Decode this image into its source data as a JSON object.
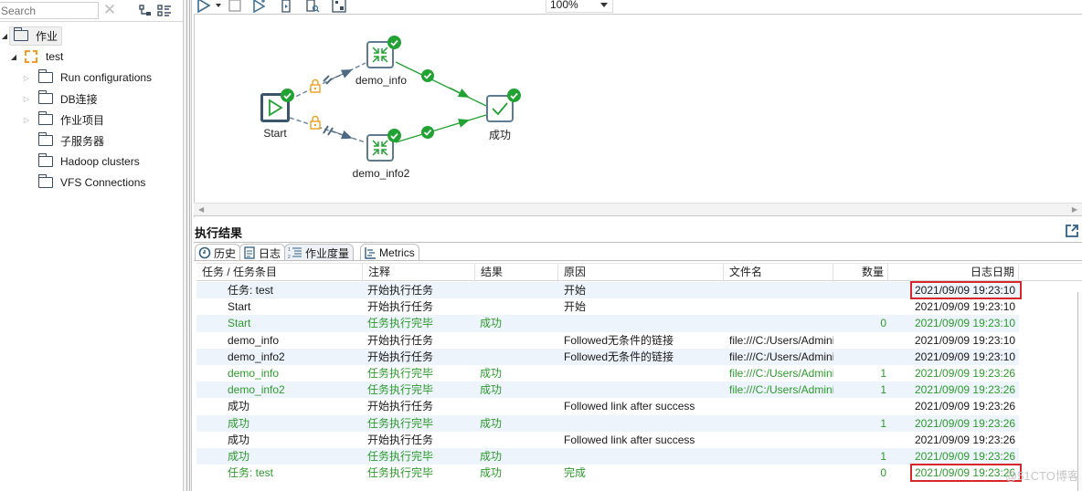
{
  "left_panel": {
    "search": {
      "placeholder": "Search",
      "value": ""
    },
    "tree": [
      {
        "label": "作业",
        "level": 0,
        "expanded": true,
        "icon": "folder-icon",
        "selected": true
      },
      {
        "label": "test",
        "level": 1,
        "expanded": true,
        "icon": "job-icon"
      },
      {
        "label": "Run configurations",
        "level": 2,
        "expandable": true,
        "icon": "folder-icon"
      },
      {
        "label": "DB连接",
        "level": 2,
        "expandable": true,
        "icon": "folder-icon"
      },
      {
        "label": "作业项目",
        "level": 2,
        "expandable": true,
        "icon": "folder-icon"
      },
      {
        "label": "子服务器",
        "level": 2,
        "expandable": false,
        "icon": "folder-icon"
      },
      {
        "label": "Hadoop clusters",
        "level": 2,
        "expandable": false,
        "icon": "folder-icon"
      },
      {
        "label": "VFS Connections",
        "level": 2,
        "expandable": false,
        "icon": "folder-icon"
      }
    ]
  },
  "toolbar": {
    "zoom_value": "100%",
    "icons": [
      "run-icon",
      "run-dropdown-icon",
      "stop-icon",
      "replay-icon",
      "verify-icon",
      "analyze-icon",
      "align-icon"
    ]
  },
  "canvas": {
    "nodes": [
      {
        "id": "start",
        "label": "Start",
        "icon": "play-icon",
        "status": "success"
      },
      {
        "id": "demo_info",
        "label": "demo_info",
        "icon": "transform-icon",
        "status": "success"
      },
      {
        "id": "demo_info2",
        "label": "demo_info2",
        "icon": "transform-icon",
        "status": "success"
      },
      {
        "id": "success",
        "label": "成功",
        "icon": "checkmark-icon",
        "status": "success"
      }
    ],
    "hops": [
      {
        "from": "start",
        "to": "demo_info",
        "type": "unconditional",
        "locked": true
      },
      {
        "from": "start",
        "to": "demo_info2",
        "type": "unconditional",
        "locked": true
      },
      {
        "from": "demo_info",
        "to": "success",
        "type": "on-success"
      },
      {
        "from": "demo_info2",
        "to": "success",
        "type": "on-success"
      }
    ]
  },
  "results": {
    "title": "执行结果",
    "tabs": [
      {
        "label": "历史",
        "icon": "history-icon",
        "active": false
      },
      {
        "label": "日志",
        "icon": "log-icon",
        "active": false
      },
      {
        "label": "作业度量",
        "icon": "metrics-list-icon",
        "active": true
      },
      {
        "label": "Metrics",
        "icon": "metrics-chart-icon",
        "active": false
      }
    ],
    "columns": [
      "任务 / 任务条目",
      "注释",
      "结果",
      "原因",
      "文件名",
      "数量",
      "日志日期"
    ],
    "rows": [
      {
        "task": "任务: test",
        "comment": "开始执行任务",
        "result": "",
        "reason": "开始",
        "filename": "",
        "count": "",
        "date": "2021/09/09 19:23:10",
        "status": "plain",
        "highlight": true
      },
      {
        "task": "Start",
        "comment": "开始执行任务",
        "result": "",
        "reason": "开始",
        "filename": "",
        "count": "",
        "date": "2021/09/09 19:23:10",
        "status": "plain"
      },
      {
        "task": "Start",
        "comment": "任务执行完毕",
        "result": "成功",
        "reason": "",
        "filename": "",
        "count": "0",
        "date": "2021/09/09 19:23:10",
        "status": "ok"
      },
      {
        "task": "demo_info",
        "comment": "开始执行任务",
        "result": "",
        "reason": "Followed无条件的链接",
        "filename": "file:///C:/Users/Admini...",
        "count": "",
        "date": "2021/09/09 19:23:10",
        "status": "plain"
      },
      {
        "task": "demo_info2",
        "comment": "开始执行任务",
        "result": "",
        "reason": "Followed无条件的链接",
        "filename": "file:///C:/Users/Admini...",
        "count": "",
        "date": "2021/09/09 19:23:10",
        "status": "plain"
      },
      {
        "task": "demo_info",
        "comment": "任务执行完毕",
        "result": "成功",
        "reason": "",
        "filename": "file:///C:/Users/Admini...",
        "count": "1",
        "date": "2021/09/09 19:23:26",
        "status": "ok"
      },
      {
        "task": "demo_info2",
        "comment": "任务执行完毕",
        "result": "成功",
        "reason": "",
        "filename": "file:///C:/Users/Admini...",
        "count": "1",
        "date": "2021/09/09 19:23:26",
        "status": "ok"
      },
      {
        "task": "成功",
        "comment": "开始执行任务",
        "result": "",
        "reason": "Followed link after success",
        "filename": "",
        "count": "",
        "date": "2021/09/09 19:23:26",
        "status": "plain"
      },
      {
        "task": "成功",
        "comment": "任务执行完毕",
        "result": "成功",
        "reason": "",
        "filename": "",
        "count": "1",
        "date": "2021/09/09 19:23:26",
        "status": "ok"
      },
      {
        "task": "成功",
        "comment": "开始执行任务",
        "result": "",
        "reason": "Followed link after success",
        "filename": "",
        "count": "",
        "date": "2021/09/09 19:23:26",
        "status": "plain"
      },
      {
        "task": "成功",
        "comment": "任务执行完毕",
        "result": "成功",
        "reason": "",
        "filename": "",
        "count": "1",
        "date": "2021/09/09 19:23:26",
        "status": "ok"
      },
      {
        "task": "任务: test",
        "comment": "任务执行完毕",
        "result": "成功",
        "reason": "完成",
        "filename": "",
        "count": "0",
        "date": "2021/09/09 19:23:26",
        "status": "ok",
        "highlight": true
      }
    ]
  },
  "colors": {
    "success_green": "#21a233",
    "ok_text": "#2d9a2d",
    "highlight_red": "#d9262b",
    "hop_gray": "#5e7a8f",
    "lock_orange": "#f0a020"
  },
  "watermark": "@51CTO博客"
}
